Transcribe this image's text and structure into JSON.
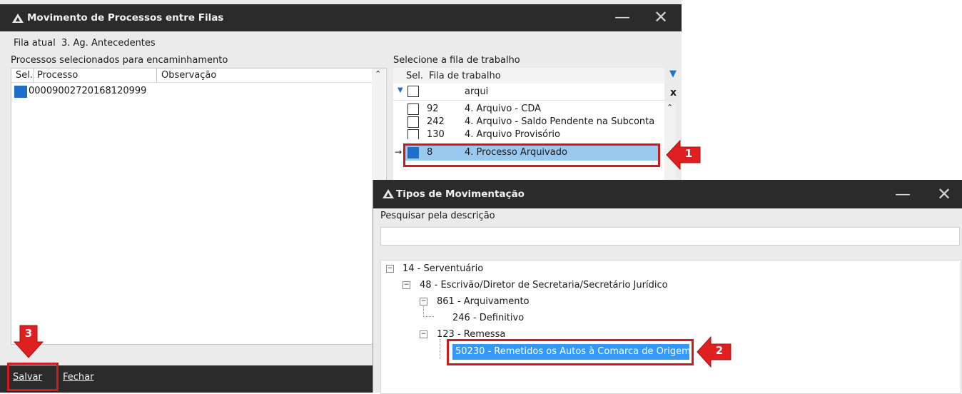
{
  "main_window": {
    "title": "Movimento de Processos entre Filas",
    "fila_atual_label": "Fila atual",
    "fila_atual_value": "3. Ag. Antecedentes",
    "left_panel_title": "Processos selecionados para encaminhamento",
    "left_columns": [
      "Sel.",
      "Processo",
      "Observação"
    ],
    "left_rows": [
      {
        "processo": "00009002720168120999",
        "checked": true
      }
    ],
    "right_panel_title": "Selecione a fila de trabalho",
    "right_columns": [
      "Sel.",
      "Fila de trabalho"
    ],
    "filter_value": "arqui",
    "clear_filter": "x",
    "queue_rows": [
      {
        "id": "92",
        "name": "4. Arquivo - CDA",
        "checked": false
      },
      {
        "id": "242",
        "name": "4. Arquivo - Saldo Pendente na Subconta",
        "checked": false
      },
      {
        "id": "130",
        "name": "4. Arquivo Provisório",
        "checked": false
      },
      {
        "id": "8",
        "name": "4. Processo Arquivado",
        "checked": true
      }
    ],
    "save_label": "Salvar",
    "close_label": "Fechar"
  },
  "dialog": {
    "title": "Tipos de Movimentação",
    "search_label": "Pesquisar pela descrição",
    "search_value": "",
    "tree": [
      {
        "label": "14 - Serventuário"
      },
      {
        "label": "48 - Escrivão/Diretor de Secretaria/Secretário Jurídico"
      },
      {
        "label": "861 - Arquivamento"
      },
      {
        "label": "246 - Definitivo"
      },
      {
        "label": "123 - Remessa"
      },
      {
        "label": "50230 - Remetidos os Autos à Comarca de Origem"
      }
    ]
  },
  "callouts": [
    "1",
    "2",
    "3"
  ],
  "colors": {
    "titlebar": "#2b2b2b",
    "highlight": "#99c9ef",
    "selected_blue": "#3399ff",
    "callout_red": "#e02020"
  }
}
